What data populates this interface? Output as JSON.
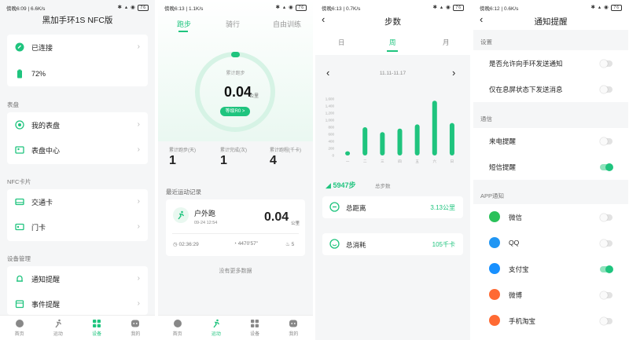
{
  "status": [
    {
      "time": "傍晚6:09 | 6.6K/s",
      "battery": "76"
    },
    {
      "time": "傍晚6:13 | 1.1K/s",
      "battery": "76"
    },
    {
      "time": "傍晚6:13 | 0.7K/s",
      "battery": "76"
    },
    {
      "time": "傍晚6:12 | 0.6K/s",
      "battery": "76"
    }
  ],
  "s1": {
    "title": "黑加手环1S NFC版",
    "connected": "已连接",
    "battery": "72%",
    "sec_watch": "表盘",
    "my_watch": "我的表盘",
    "watch_center": "表盘中心",
    "sec_nfc": "NFC卡片",
    "transit": "交通卡",
    "door": "门卡",
    "sec_device": "设备管理",
    "notify": "通知提醒",
    "event": "事件提醒"
  },
  "nav": {
    "home": "首页",
    "sport": "运动",
    "device": "设备",
    "mine": "我的"
  },
  "s2": {
    "tabs": [
      "跑步",
      "骑行",
      "自由训练"
    ],
    "ring_label": "累计跑步",
    "distance": "0.04",
    "unit": "公里",
    "level_btn": "等级R0 >",
    "stats": [
      {
        "label": "累计跑步(天)",
        "value": "1"
      },
      {
        "label": "累计完成(次)",
        "value": "1"
      },
      {
        "label": "累计跑程(千卡)",
        "value": "4"
      }
    ],
    "recent_title": "最近运动记录",
    "record_type": "户外跑",
    "record_date": "09-24 12:54",
    "record_dist": "0.04",
    "record_unit": "公里",
    "record_time": "02:36:29",
    "record_pace": "4470'57\"",
    "record_cal": "5",
    "no_more": "没有更多数据"
  },
  "s3": {
    "title": "步数",
    "tabs": [
      "日",
      "周",
      "月"
    ],
    "range": "11.11-11.17",
    "steps": "5947步",
    "steps_label": "总步数",
    "dist_label": "总距离",
    "dist_val": "3.13公里",
    "cal_label": "总消耗",
    "cal_val": "105千卡"
  },
  "chart_data": {
    "type": "bar",
    "categories": [
      "一",
      "二",
      "三",
      "四",
      "五",
      "六",
      "日"
    ],
    "values": [
      120,
      800,
      660,
      760,
      880,
      1550,
      920
    ],
    "yticks": [
      "1,600",
      "1,400",
      "1,200",
      "1,000",
      "800",
      "600",
      "400",
      "200",
      "0"
    ],
    "ylim": [
      0,
      1600
    ],
    "color": "#1fc47e"
  },
  "s4": {
    "title": "通知提醒",
    "sec_settings": "设置",
    "allow_push": "是否允许向手环发送通知",
    "screen_off": "仅在息屏状态下发送消息",
    "sec_call": "通信",
    "call": "来电提醒",
    "sms": "短信提醒",
    "sec_app": "APP通知",
    "apps": [
      {
        "label": "微信",
        "on": false,
        "color": "#2bc15a"
      },
      {
        "label": "QQ",
        "on": false,
        "color": "#2196f3"
      },
      {
        "label": "支付宝",
        "on": true,
        "color": "#1890ff"
      },
      {
        "label": "微博",
        "on": false,
        "color": "#ff6a33"
      },
      {
        "label": "手机淘宝",
        "on": false,
        "color": "#ff6a33"
      }
    ]
  }
}
